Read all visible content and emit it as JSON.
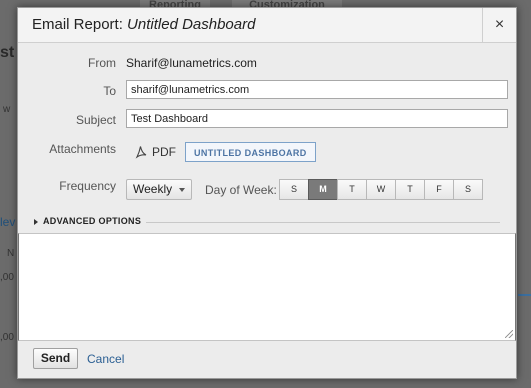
{
  "background": {
    "tabs": [
      "Reporting",
      "Customization"
    ],
    "left_fragment": "st",
    "side_fragments": [
      "w",
      "lev",
      "N",
      ",00",
      ",00"
    ]
  },
  "dialog": {
    "title_prefix": "Email Report: ",
    "title_name": "Untitled Dashboard",
    "close_label": "×",
    "from": {
      "label": "From",
      "value": "Sharif@lunametrics.com"
    },
    "to": {
      "label": "To",
      "value": "sharif@lunametrics.com"
    },
    "subject": {
      "label": "Subject",
      "value": "Test Dashboard"
    },
    "attachments": {
      "label": "Attachments",
      "format": "PDF",
      "chip": "UNTITLED DASHBOARD"
    },
    "frequency": {
      "label": "Frequency",
      "value": "Weekly"
    },
    "day_of_week": {
      "label": "Day of Week:",
      "days": [
        "S",
        "M",
        "T",
        "W",
        "T",
        "F",
        "S"
      ],
      "selected_index": 1
    },
    "advanced_options": "ADVANCED OPTIONS",
    "message": "",
    "send_label": "Send",
    "cancel_label": "Cancel"
  },
  "colors": {
    "accent_chip": "#4d74a4",
    "selected_day": "#7a7a7a",
    "link": "#2b5f93"
  }
}
